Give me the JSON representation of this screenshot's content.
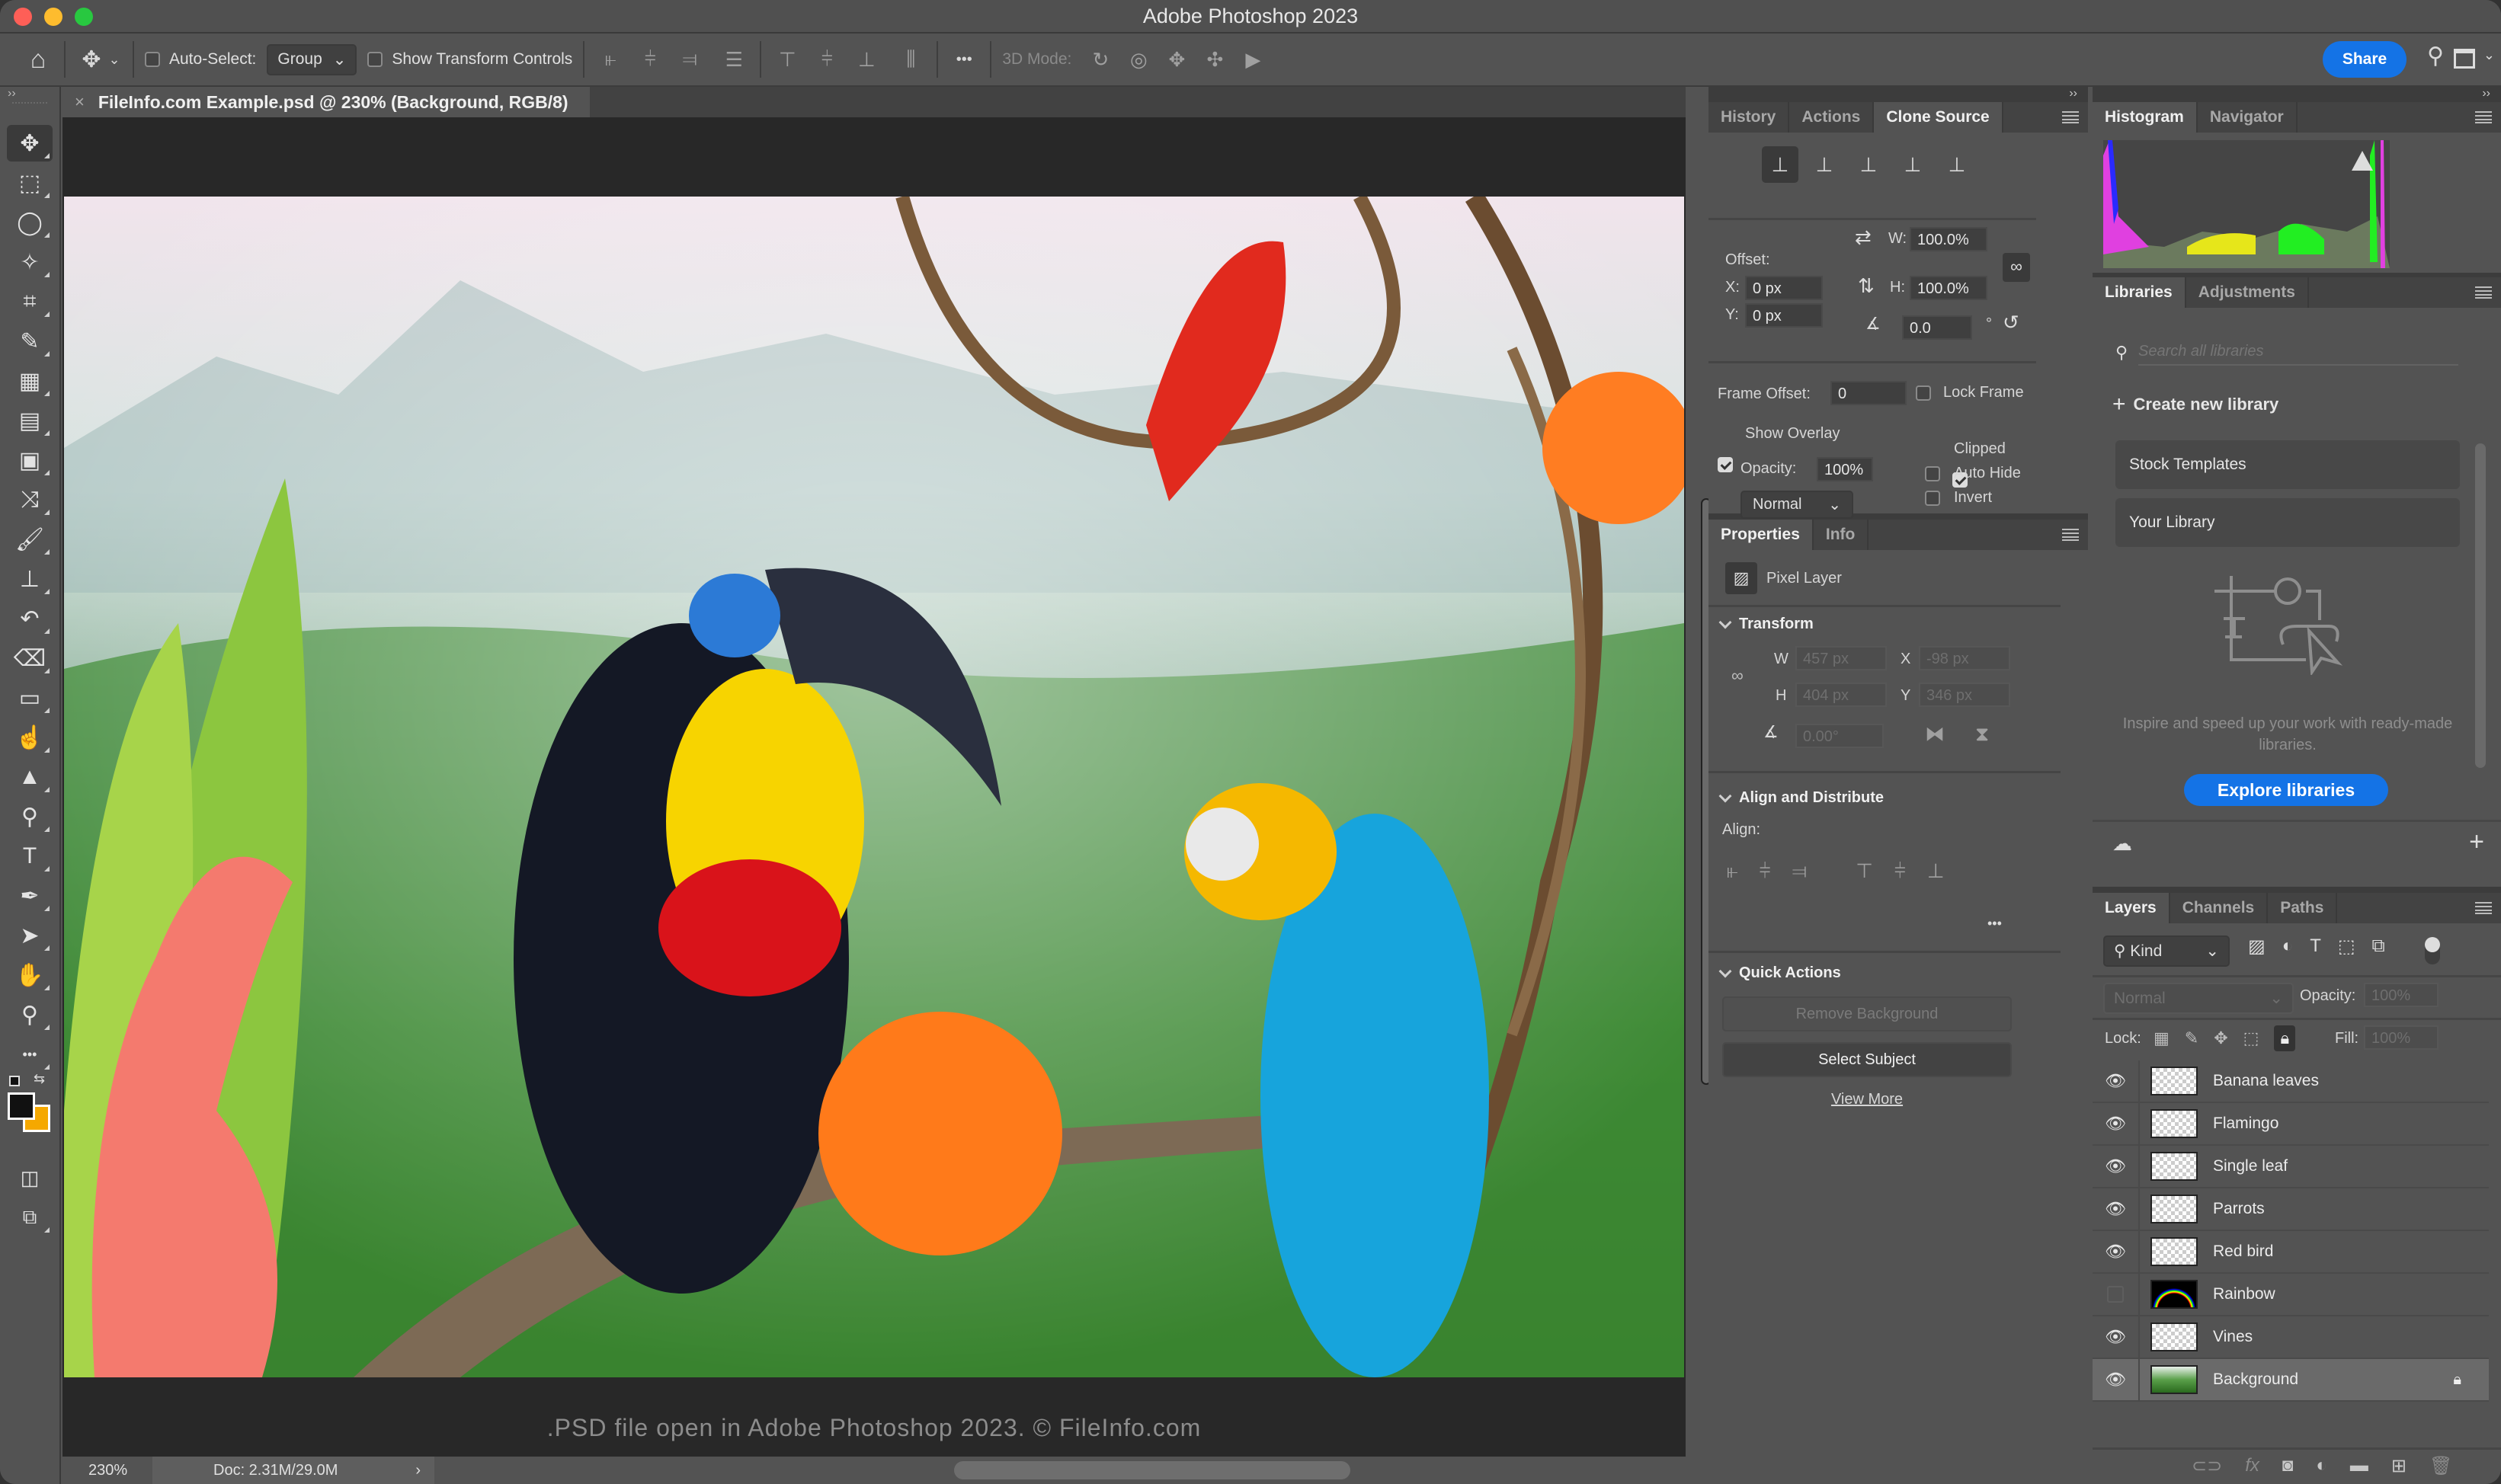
{
  "window": {
    "title": "Adobe Photoshop 2023"
  },
  "options_bar": {
    "auto_select_label": "Auto-Select:",
    "auto_select_checked": false,
    "auto_select_value": "Group",
    "show_transform_label": "Show Transform Controls",
    "show_transform_checked": false,
    "more_label": "•••",
    "mode3d_label": "3D Mode:",
    "share_label": "Share"
  },
  "document": {
    "tab_title": "FileInfo.com Example.psd @ 230% (Background, RGB/8)",
    "caption": ".PSD file open in Adobe Photoshop 2023. © FileInfo.com",
    "zoom": "230%",
    "doc_size": "Doc: 2.31M/29.0M"
  },
  "tools": [
    {
      "name": "move-tool",
      "glyph": "✥",
      "active": true
    },
    {
      "name": "marquee-tool",
      "glyph": "⬚"
    },
    {
      "name": "lasso-tool",
      "glyph": "◯"
    },
    {
      "name": "magic-wand-tool",
      "glyph": "✧"
    },
    {
      "name": "crop-tool",
      "glyph": "⌗"
    },
    {
      "name": "eyedropper-tool",
      "glyph": "✎"
    },
    {
      "name": "spot-healing-tool",
      "glyph": "▦"
    },
    {
      "name": "healing-brush-tool",
      "glyph": "▤"
    },
    {
      "name": "patch-tool",
      "glyph": "▣"
    },
    {
      "name": "content-aware-move-tool",
      "glyph": "⤨"
    },
    {
      "name": "brush-tool",
      "glyph": "🖌"
    },
    {
      "name": "clone-stamp-tool",
      "glyph": "⊥"
    },
    {
      "name": "history-brush-tool",
      "glyph": "↶"
    },
    {
      "name": "eraser-tool",
      "glyph": "⌫"
    },
    {
      "name": "gradient-tool",
      "glyph": "▭"
    },
    {
      "name": "smudge-tool",
      "glyph": "☝"
    },
    {
      "name": "sharpen-tool",
      "glyph": "▲"
    },
    {
      "name": "dodge-tool",
      "glyph": "⚲"
    },
    {
      "name": "type-tool",
      "glyph": "T"
    },
    {
      "name": "pen-tool",
      "glyph": "✒"
    },
    {
      "name": "path-selection-tool",
      "glyph": "➤"
    },
    {
      "name": "hand-tool",
      "glyph": "✋"
    },
    {
      "name": "zoom-tool",
      "glyph": "⚲"
    },
    {
      "name": "more-tools",
      "glyph": "•••"
    }
  ],
  "colors": {
    "foreground": "#111111",
    "background": "#f5a800",
    "accent": "#1473e6"
  },
  "clone_source": {
    "tabs": [
      "History",
      "Actions",
      "Clone Source"
    ],
    "active_tab": "Clone Source",
    "offset_label": "Offset:",
    "x_label": "X:",
    "x_value": "0 px",
    "y_label": "Y:",
    "y_value": "0 px",
    "w_label": "W:",
    "w_value": "100.0%",
    "h_label": "H:",
    "h_value": "100.0%",
    "angle_value": "0.0",
    "degree": "°",
    "frame_offset_label": "Frame Offset:",
    "frame_offset_value": "0",
    "lock_frame_label": "Lock Frame",
    "lock_frame_checked": false,
    "show_overlay_label": "Show Overlay",
    "show_overlay_checked": true,
    "opacity_label": "Opacity:",
    "opacity_value": "100%",
    "blend_mode": "Normal",
    "clipped_label": "Clipped",
    "clipped_checked": true,
    "auto_hide_label": "Auto Hide",
    "auto_hide_checked": false,
    "invert_label": "Invert",
    "invert_checked": false
  },
  "properties": {
    "tabs": [
      "Properties",
      "Info"
    ],
    "layer_type": "Pixel Layer",
    "transform_label": "Transform",
    "w_label": "W",
    "w_value": "457 px",
    "h_label": "H",
    "h_value": "404 px",
    "x_label": "X",
    "x_value": "-98 px",
    "y_label": "Y",
    "y_value": "346 px",
    "angle_value": "0.00°",
    "align_distribute_label": "Align and Distribute",
    "align_label": "Align:",
    "quick_actions_label": "Quick Actions",
    "remove_bg_label": "Remove Background",
    "select_subject_label": "Select Subject",
    "view_more_label": "View More"
  },
  "histogram": {
    "tabs": [
      "Histogram",
      "Navigator"
    ]
  },
  "libraries": {
    "tabs": [
      "Libraries",
      "Adjustments"
    ],
    "search_placeholder": "Search all libraries",
    "create_label": "Create new library",
    "items": [
      "Stock Templates",
      "Your Library"
    ],
    "promo_text": "Inspire and speed up your work with ready-made libraries.",
    "explore_label": "Explore libraries"
  },
  "layers_panel": {
    "tabs": [
      "Layers",
      "Channels",
      "Paths"
    ],
    "filter_label": "Kind",
    "blend_mode": "Normal",
    "opacity_label": "Opacity:",
    "opacity_value": "100%",
    "lock_label": "Lock:",
    "fill_label": "Fill:",
    "fill_value": "100%",
    "layers": [
      {
        "name": "Banana leaves",
        "visible": true,
        "selected": false,
        "locked": false
      },
      {
        "name": "Flamingo",
        "visible": true,
        "selected": false,
        "locked": false
      },
      {
        "name": "Single leaf",
        "visible": true,
        "selected": false,
        "locked": false
      },
      {
        "name": "Parrots",
        "visible": true,
        "selected": false,
        "locked": false
      },
      {
        "name": "Red bird",
        "visible": true,
        "selected": false,
        "locked": false
      },
      {
        "name": "Rainbow",
        "visible": false,
        "selected": false,
        "locked": false
      },
      {
        "name": "Vines",
        "visible": true,
        "selected": false,
        "locked": false
      },
      {
        "name": "Background",
        "visible": true,
        "selected": true,
        "locked": true
      }
    ]
  }
}
